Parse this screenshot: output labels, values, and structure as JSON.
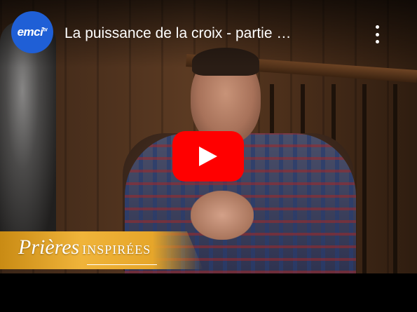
{
  "window": {
    "background": "#000000"
  },
  "channel": {
    "name": "emci",
    "badge": "tv",
    "avatar_color": "#1f5fd6"
  },
  "video": {
    "title": "La puissance de la croix - partie …"
  },
  "controls": {
    "more_icon": "vertical-ellipsis-icon",
    "play_icon": "youtube-play-icon",
    "play_color": "#ff0000"
  },
  "lower_third": {
    "script_text": "Prières",
    "caps_text": "INSPIRÉES",
    "accent": "#e6a62a"
  }
}
